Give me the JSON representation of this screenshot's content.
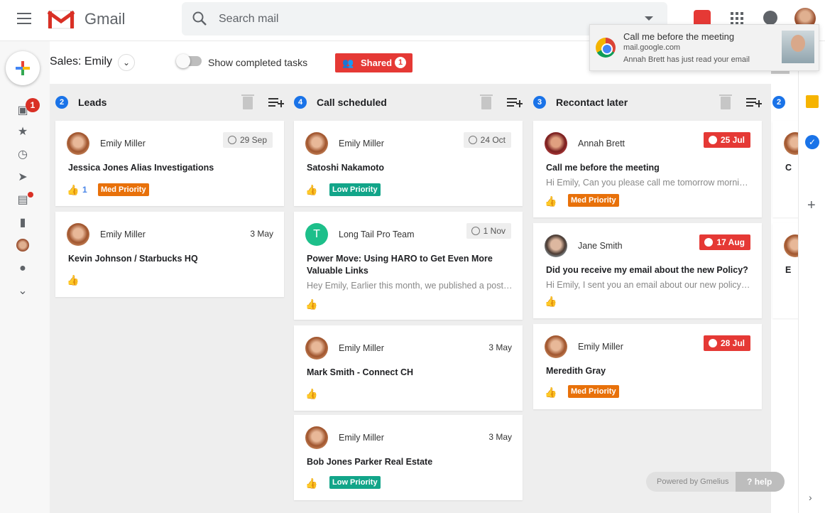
{
  "app": {
    "name": "Gmail"
  },
  "search": {
    "placeholder": "Search mail"
  },
  "notification": {
    "title": "Call me before the meeting",
    "site": "mail.google.com",
    "body": "Annah Brett has just read your email"
  },
  "rail": {
    "inbox_badge": "1"
  },
  "header": {
    "board_title": "Sales: Emily",
    "toggle_label": "Show completed tasks",
    "shared_label": "Shared",
    "shared_count": "1"
  },
  "columns": [
    {
      "number": "2",
      "title": "Leads",
      "cards": [
        {
          "sender": "Emily Miller",
          "date": "29 Sep",
          "subject": "Jessica Jones Alias Investigations",
          "likes": "1",
          "tag": "Med Priority"
        },
        {
          "sender": "Emily Miller",
          "date": "3 May",
          "subject": "Kevin Johnson / Starbucks HQ"
        }
      ]
    },
    {
      "number": "4",
      "title": "Call scheduled",
      "cards": [
        {
          "sender": "Emily Miller",
          "date": "24 Oct",
          "subject": "Satoshi Nakamoto",
          "tag": "Low Priority"
        },
        {
          "avatar_letter": "T",
          "sender": "Long Tail Pro Team",
          "date": "1 Nov",
          "subject": "Power Move: Using HARO to Get Even More Valuable Links",
          "preview": "Hey Emily, Earlier this month, we published a post about"
        },
        {
          "sender": "Emily Miller",
          "date": "3 May",
          "subject": "Mark Smith - Connect CH"
        },
        {
          "sender": "Emily Miller",
          "date": "3 May",
          "subject": "Bob Jones Parker Real Estate",
          "tag": "Low Priority"
        }
      ]
    },
    {
      "number": "3",
      "title": "Recontact later",
      "cards": [
        {
          "sender": "Annah Brett",
          "date": "25 Jul",
          "subject": "Call me before the meeting",
          "preview": "Hi Emily, Can you please call me tomorrow morning before",
          "tag": "Med Priority"
        },
        {
          "sender": "Jane Smith",
          "date": "17 Aug",
          "subject": "Did you receive my email about the new Policy?",
          "preview": "Hi Emily, I sent you an email about our new policy last week"
        },
        {
          "sender": "Emily Miller",
          "date": "28 Jul",
          "subject": "Meredith Gray",
          "tag": "Med Priority"
        }
      ]
    },
    {
      "number": "2",
      "cards_partial": [
        {
          "subject_fragment": "C"
        },
        {
          "subject_fragment": "E"
        }
      ]
    }
  ],
  "footer": {
    "powered": "Powered by Gmelius",
    "help": "help"
  },
  "colors": {
    "accent_red": "#e53935",
    "blue": "#1a73e8",
    "med_priority": "#e8710a",
    "low_priority": "#12a589"
  },
  "icons": [
    "menu-icon",
    "gmail-logo-icon",
    "search-icon",
    "gmelius-icon",
    "apps-icon",
    "notifications-icon",
    "compose-icon",
    "inbox-icon",
    "star-icon",
    "clock-icon",
    "send-icon",
    "draft-icon",
    "label-icon",
    "contacts-icon",
    "keep-icon",
    "tasks-icon",
    "add-icon",
    "trash-icon",
    "playlist-add-icon",
    "thumb-up-icon",
    "clock-date-icon",
    "alert-icon",
    "help-icon"
  ]
}
